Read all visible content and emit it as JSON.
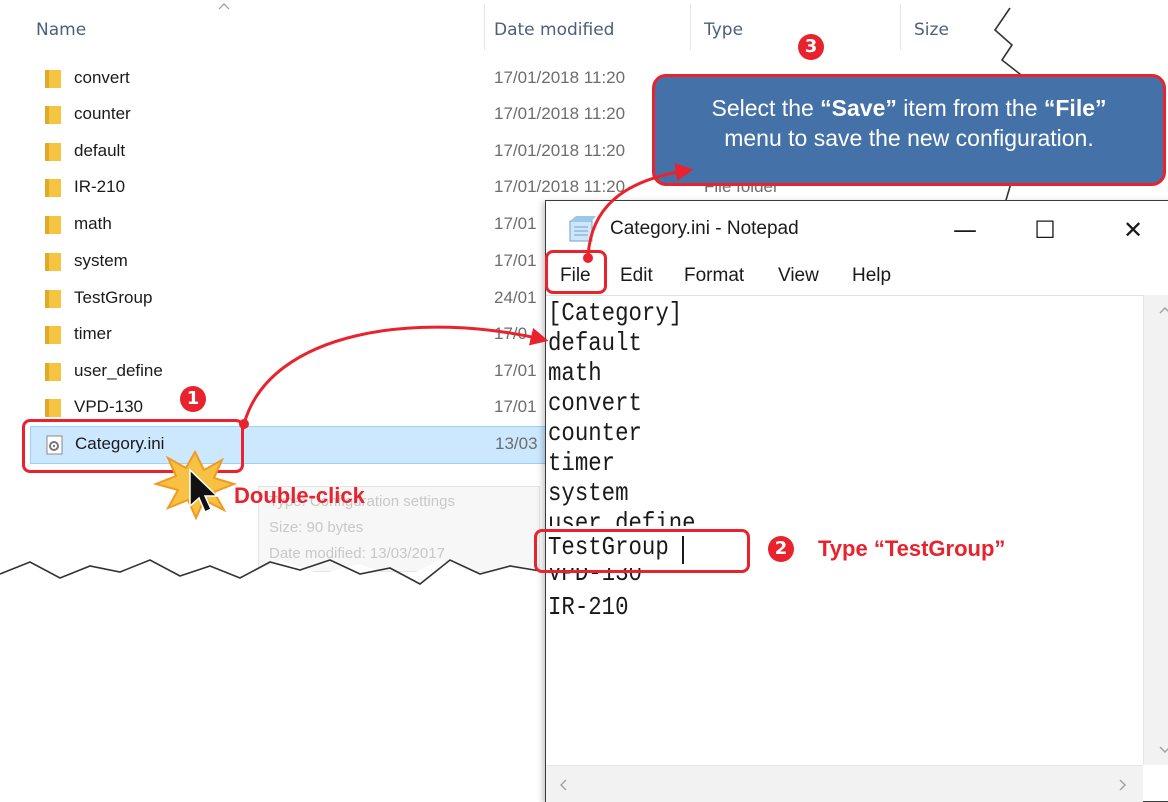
{
  "explorer": {
    "columns": {
      "name": "Name",
      "date": "Date modified",
      "type": "Type",
      "size": "Size"
    },
    "files": [
      {
        "name": "convert",
        "date": "17/01/2018 11:20"
      },
      {
        "name": "counter",
        "date": "17/01/2018 11:20"
      },
      {
        "name": "default",
        "date": "17/01/2018 11:20"
      },
      {
        "name": "IR-210",
        "date": "17/01/2018 11:20",
        "type": "File folder"
      },
      {
        "name": "math",
        "date": "17/01"
      },
      {
        "name": "system",
        "date": "17/01"
      },
      {
        "name": "TestGroup",
        "date": "24/01"
      },
      {
        "name": "timer",
        "date": "17/0"
      },
      {
        "name": "user_define",
        "date": "17/01"
      },
      {
        "name": "VPD-130",
        "date": "17/01"
      },
      {
        "name": "Category.ini",
        "date": "13/03"
      }
    ],
    "tooltip": {
      "line1": "Type: Configuration settings",
      "line2": "Size: 90 bytes",
      "line3": "Date modified: 13/03/2017"
    }
  },
  "notepad": {
    "title": "Category.ini - Notepad",
    "controls": {
      "minimize": "—",
      "maximize": "☐",
      "close": "✕"
    },
    "menu": [
      "File",
      "Edit",
      "Format",
      "View",
      "Help"
    ],
    "lines": [
      "[Category]",
      "default",
      "math",
      "convert",
      "counter",
      "timer",
      "system",
      "user_define",
      "TestGroup",
      "VPD-130",
      "IR-210"
    ]
  },
  "annotations": {
    "step1": "1",
    "step2": "2",
    "step3": "3",
    "double_click": "Double-click",
    "type_instruction": "Type “TestGroup”",
    "tip_line1_pre": "Select the ",
    "tip_save": "“Save”",
    "tip_line1_mid": " item from the ",
    "tip_file": "“File”",
    "tip_line2": "menu to save the new configuration."
  },
  "colors": {
    "accent_red": "#e8232d",
    "tip_blue": "#4472a8",
    "selection": "#cce8ff",
    "folder": "#f5c542"
  }
}
